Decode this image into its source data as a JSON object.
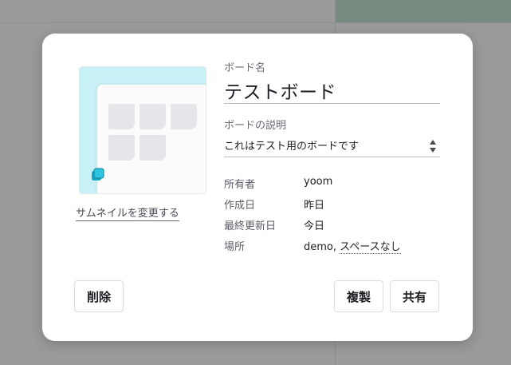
{
  "dialog": {
    "change_thumbnail": "サムネイルを変更する",
    "board_name_label": "ボード名",
    "board_name": "テストボード",
    "description_label": "ボードの説明",
    "description": "これはテスト用のボードです",
    "meta": {
      "owner_label": "所有者",
      "owner": "yoom",
      "created_label": "作成日",
      "created": "昨日",
      "updated_label": "最終更新日",
      "updated": "今日",
      "location_label": "場所",
      "location_prefix": "demo,",
      "location_link": "スペースなし"
    },
    "buttons": {
      "delete": "削除",
      "duplicate": "複製",
      "share": "共有"
    }
  },
  "colors": {
    "thumbnail_bg": "#c9f1f8",
    "logo": "#2ec5e0",
    "overlay": "#9a9a9a"
  },
  "icons": {
    "thumbnail_logo": "board-logo-icon",
    "select_arrows": "sort-arrows-icon"
  }
}
